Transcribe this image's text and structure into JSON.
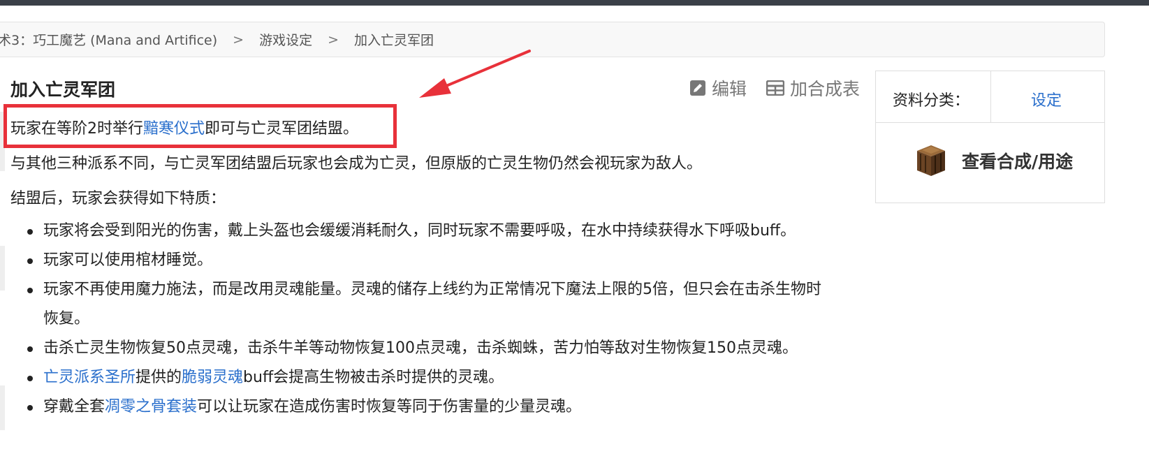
{
  "breadcrumb": {
    "items": [
      "术3：巧工魔艺 (Mana and Artifice)",
      "游戏设定",
      "加入亡灵军团"
    ],
    "separator": ">"
  },
  "page": {
    "title": "加入亡灵军团"
  },
  "toolbar": {
    "edit_label": "编辑",
    "edit_icon": "pencil-square-icon",
    "craft_table_label": "加合成表",
    "craft_table_icon": "table-icon"
  },
  "content": {
    "intro": {
      "before": "玩家在等阶2时举行",
      "link": "黯寒仪式",
      "after": "即可与亡灵军团结盟。"
    },
    "para2": "与其他三种派系不同，与亡灵军团结盟后玩家也会成为亡灵，但原版的亡灵生物仍然会视玩家为敌人。",
    "para3": "结盟后，玩家会获得如下特质：",
    "traits": [
      {
        "text": "玩家将会受到阳光的伤害，戴上头盔也会缓缓消耗耐久，同时玩家不需要呼吸，在水中持续获得水下呼吸buff。"
      },
      {
        "text": "玩家可以使用棺材睡觉。"
      },
      {
        "line1": "玩家不再使用魔力施法，而是改用灵魂能量。灵魂的储存上线约为正常情况下魔法上限的5倍，但只会在击杀生物时",
        "line2": "恢复。"
      },
      {
        "text": "击杀亡灵生物恢复50点灵魂，击杀牛羊等动物恢复100点灵魂，击杀蜘蛛，苦力怕等敌对生物恢复150点灵魂。"
      },
      {
        "link1": "亡灵派系圣所",
        "mid1": "提供的",
        "link2": "脆弱灵魂",
        "rest": "buff会提高生物被击杀时提供的灵魂。"
      },
      {
        "before": "穿戴全套",
        "link": "凋零之骨套装",
        "after": "可以让玩家在造成伤害时恢复等同于伤害量的少量灵魂。"
      }
    ]
  },
  "infobox": {
    "category_label": "资料分类：",
    "category_value": "设定",
    "view_recipe_label": "查看合成/用途",
    "view_recipe_icon": "crafting-table-icon"
  },
  "annotation": {
    "color": "#e8313a"
  },
  "colors": {
    "link": "#2a6fcc",
    "highlight": "#e8313a",
    "topbar": "#3a4048"
  }
}
